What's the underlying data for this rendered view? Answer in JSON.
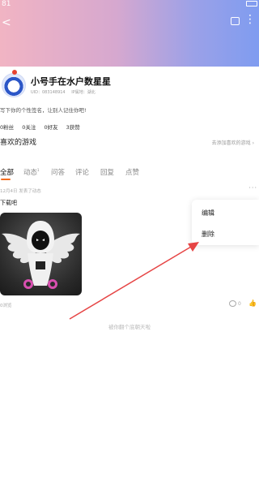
{
  "status": {
    "time": "81"
  },
  "profile": {
    "username": "小号手在水户数星星",
    "uid": "UID：083148914",
    "ip": "IP属地：湖北",
    "signature": "写下你的个性签名，让别人记住你吧!",
    "stats": [
      "0粉丝",
      "0关注",
      "0好友",
      "3获赞"
    ]
  },
  "favorites": {
    "title": "喜欢的游戏",
    "add_link": "去添加喜欢的游戏"
  },
  "tabs": [
    {
      "label": "全部",
      "active": true
    },
    {
      "label": "动态",
      "sup": "1"
    },
    {
      "label": "问答"
    },
    {
      "label": "评论"
    },
    {
      "label": "回复"
    },
    {
      "label": "点赞"
    }
  ],
  "post": {
    "date": "12月4日 发表了动态",
    "text": "下载吧",
    "views": "0浏览",
    "comments": "0"
  },
  "end_text": "被你翻个底朝天啦",
  "popup": {
    "edit": "编辑",
    "delete": "删除"
  },
  "colors": {
    "accent": "#f36d1f",
    "arrow": "#e64545"
  }
}
